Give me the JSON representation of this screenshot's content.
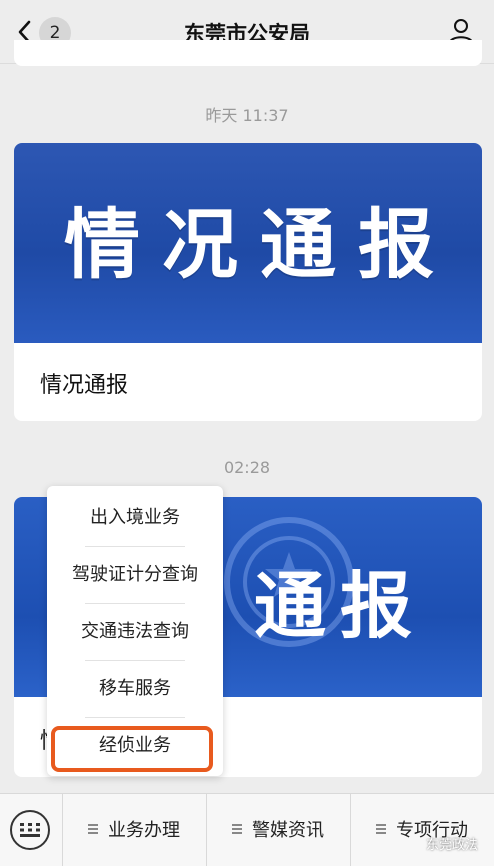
{
  "header": {
    "back_count": "2",
    "title": "东莞市公安局"
  },
  "messages": [
    {
      "timestamp": "昨天 11:37",
      "banner_text": "情况通报",
      "caption": "情况通报"
    },
    {
      "timestamp": "02:28",
      "banner_text": "通报",
      "caption": "情"
    }
  ],
  "popup_menu": {
    "items": [
      "出入境业务",
      "驾驶证计分查询",
      "交通违法查询",
      "移车服务",
      "经侦业务"
    ],
    "highlighted": "经侦业务"
  },
  "bottom_tabs": [
    "业务办理",
    "警媒资讯",
    "专项行动"
  ],
  "watermark": "东莞政法",
  "colors": {
    "banner_blue": "#2a56b6",
    "highlight_orange": "#e85a1e"
  }
}
